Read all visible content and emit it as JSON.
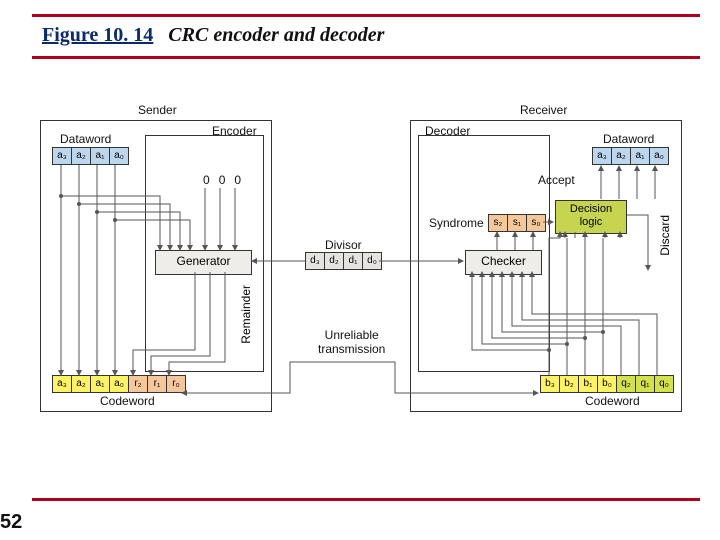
{
  "figure": {
    "number": "Figure 10. 14",
    "caption": "CRC encoder and decoder"
  },
  "page_number": "52",
  "sender_label": "Sender",
  "receiver_label": "Receiver",
  "encoder_label": "Encoder",
  "decoder_label": "Decoder",
  "dataword_label": "Dataword",
  "codeword_label": "Codeword",
  "divisor_label": "Divisor",
  "unreliable_label_1": "Unreliable",
  "unreliable_label_2": "transmission",
  "generator_label": "Generator",
  "checker_label": "Checker",
  "remainder_label": "Remainder",
  "syndrome_label": "Syndrome",
  "accept_label": "Accept",
  "discard_label": "Discard",
  "decision_label_1": "Decision",
  "decision_label_2": "logic",
  "zeros": [
    "0",
    "0",
    "0"
  ],
  "a_bits": [
    "a₃",
    "a₂",
    "a₁",
    "a₀"
  ],
  "r_bits": [
    "r₂",
    "r₁",
    "r₀"
  ],
  "d_bits": [
    "d₃",
    "d₂",
    "d₁",
    "d₀"
  ],
  "s_bits": [
    "s₂",
    "s₁",
    "s₀"
  ],
  "b_bits": [
    "b₃",
    "b₂",
    "b₁",
    "b₀"
  ],
  "q_bits": [
    "q₂",
    "q₁",
    "q₀"
  ]
}
